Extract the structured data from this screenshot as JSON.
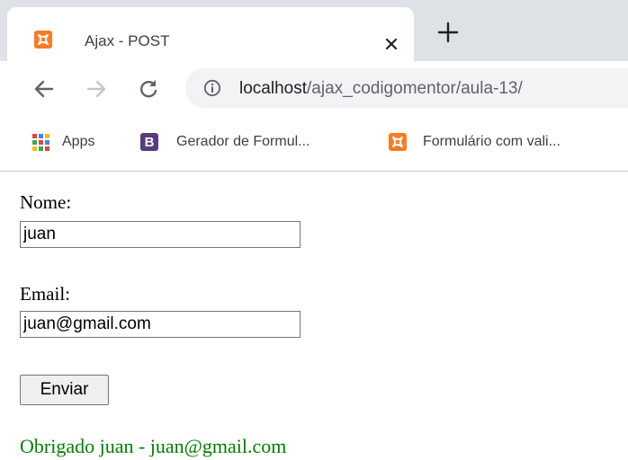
{
  "colors": {
    "tabstrip_bg": "#dee1e6",
    "omnibox_bg": "#f1f3f4",
    "xampp_orange": "#fb7a24",
    "bootstrap_purple": "#563d7c",
    "success_green": "#008000"
  },
  "tab": {
    "title": "Ajax - POST",
    "favicon": "xampp-icon",
    "close_icon": "close-icon"
  },
  "toolbar": {
    "back_icon": "arrow-left-icon",
    "forward_icon": "arrow-right-icon",
    "reload_icon": "reload-icon",
    "info_icon": "info-icon",
    "url_host": "localhost",
    "url_path": "/ajax_codigomentor/aula-13/"
  },
  "bookmarks": [
    {
      "label": "Apps",
      "icon": "apps-grid-icon"
    },
    {
      "label": "Gerador de Formul...",
      "icon": "bootstrap-icon"
    },
    {
      "label": "Formulário com vali...",
      "icon": "xampp-icon"
    }
  ],
  "bootstrap_letter": "B",
  "form": {
    "name_label": "Nome:",
    "name_value": "juan",
    "email_label": "Email:",
    "email_value": "juan@gmail.com",
    "submit_label": "Enviar"
  },
  "result_message": "Obrigado juan - juan@gmail.com"
}
